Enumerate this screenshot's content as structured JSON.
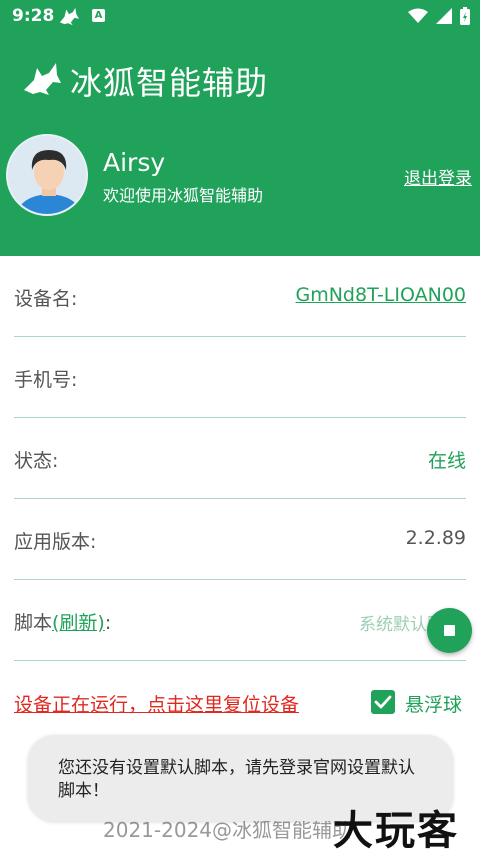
{
  "status_bar": {
    "time": "9:28",
    "notification_badge": "A"
  },
  "header": {
    "app_title": "冰狐智能辅助",
    "username": "Airsy",
    "welcome_text": "欢迎使用冰狐智能辅助",
    "logout_label": "退出登录"
  },
  "rows": {
    "device_name": {
      "label": "设备名:",
      "value": "GmNd8T-LIOAN00"
    },
    "phone": {
      "label": "手机号:",
      "value": ""
    },
    "status": {
      "label": "状态:",
      "value": "在线"
    },
    "app_version": {
      "label": "应用版本:",
      "value": "2.2.89"
    },
    "script": {
      "label_prefix": "脚本",
      "refresh_label": "(刷新)",
      "label_suffix": ":",
      "value": "系统默认脚"
    }
  },
  "reset_link": "设备正在运行，点击这里复位设备",
  "floating_ball": {
    "label": "悬浮球",
    "checked": true
  },
  "footer": "2021-2024@冰狐智能辅助",
  "toast": "您还没有设置默认脚本，请先登录官网设置默认脚本！",
  "watermark": "大玩客",
  "colors": {
    "primary": "#21a25a",
    "danger": "#e0281f",
    "divider": "#a8d9bf"
  },
  "icons": [
    "fox-icon",
    "wifi-icon",
    "signal-icon",
    "battery-icon",
    "stop-icon",
    "check-icon"
  ]
}
